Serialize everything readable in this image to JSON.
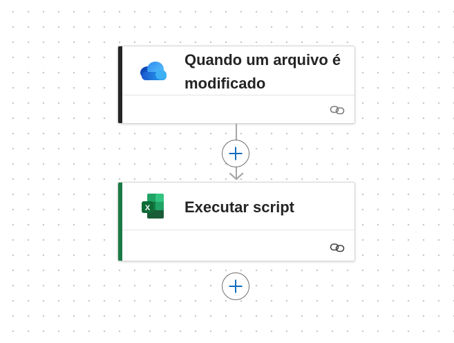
{
  "flow": {
    "trigger": {
      "title": "Quando um arquivo é modificado",
      "icon": "onedrive-icon",
      "accent_color": "#242424",
      "link_icon": "link-icon"
    },
    "action": {
      "title": "Executar script",
      "icon": "excel-icon",
      "accent_color": "#1a7a45",
      "link_icon": "link-icon"
    },
    "add_step_icon": "plus-icon",
    "accent_color_plus": "#0f6cbd"
  }
}
